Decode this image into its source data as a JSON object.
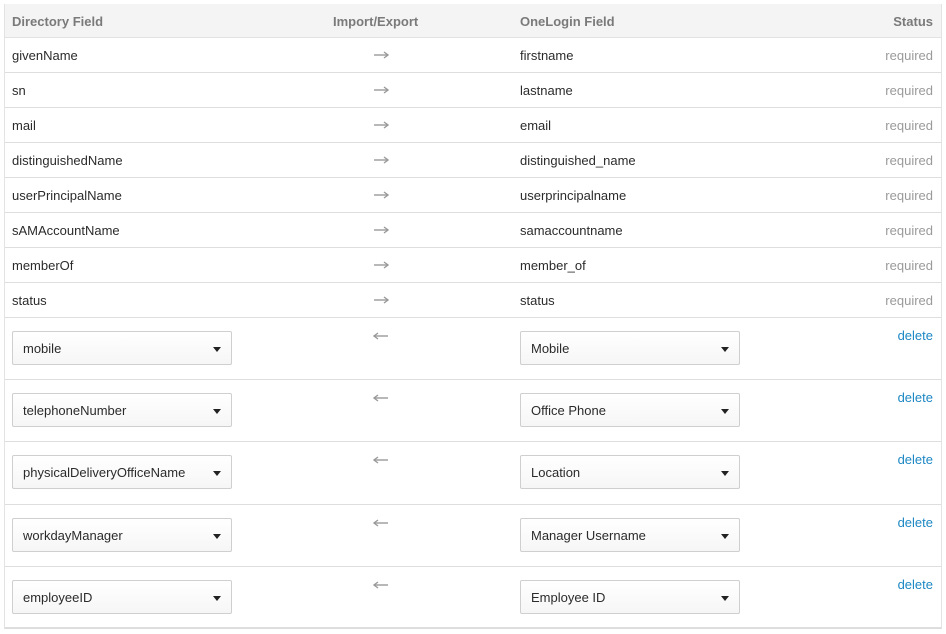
{
  "header": {
    "directory_field": "Directory Field",
    "import_export": "Import/Export",
    "onelogin_field": "OneLogin Field",
    "status": "Status"
  },
  "fixed_rows": [
    {
      "directory": "givenName",
      "onelogin": "firstname",
      "status": "required",
      "direction": "export"
    },
    {
      "directory": "sn",
      "onelogin": "lastname",
      "status": "required",
      "direction": "export"
    },
    {
      "directory": "mail",
      "onelogin": "email",
      "status": "required",
      "direction": "export"
    },
    {
      "directory": "distinguishedName",
      "onelogin": "distinguished_name",
      "status": "required",
      "direction": "export"
    },
    {
      "directory": "userPrincipalName",
      "onelogin": "userprincipalname",
      "status": "required",
      "direction": "export"
    },
    {
      "directory": "sAMAccountName",
      "onelogin": "samaccountname",
      "status": "required",
      "direction": "export"
    },
    {
      "directory": "memberOf",
      "onelogin": "member_of",
      "status": "required",
      "direction": "export"
    },
    {
      "directory": "status",
      "onelogin": "status",
      "status": "required",
      "direction": "export"
    }
  ],
  "editable_rows": [
    {
      "directory": "mobile",
      "onelogin": "Mobile",
      "action": "delete",
      "direction": "import"
    },
    {
      "directory": "telephoneNumber",
      "onelogin": "Office Phone",
      "action": "delete",
      "direction": "import"
    },
    {
      "directory": "physicalDeliveryOfficeName",
      "onelogin": "Location",
      "action": "delete",
      "direction": "import"
    },
    {
      "directory": "workdayManager",
      "onelogin": "Manager Username",
      "action": "delete",
      "direction": "import"
    },
    {
      "directory": "employeeID",
      "onelogin": "Employee ID",
      "action": "delete",
      "direction": "import"
    }
  ],
  "icons": {
    "export_arrow": "arrow-right-icon",
    "import_arrow": "arrow-left-icon",
    "dropdown": "caret-down-icon"
  },
  "colors": {
    "link": "#1d88c4",
    "status_text": "#9a9a9a",
    "header_bg": "#f4f4f4",
    "arrow": "#9a9a9a"
  }
}
